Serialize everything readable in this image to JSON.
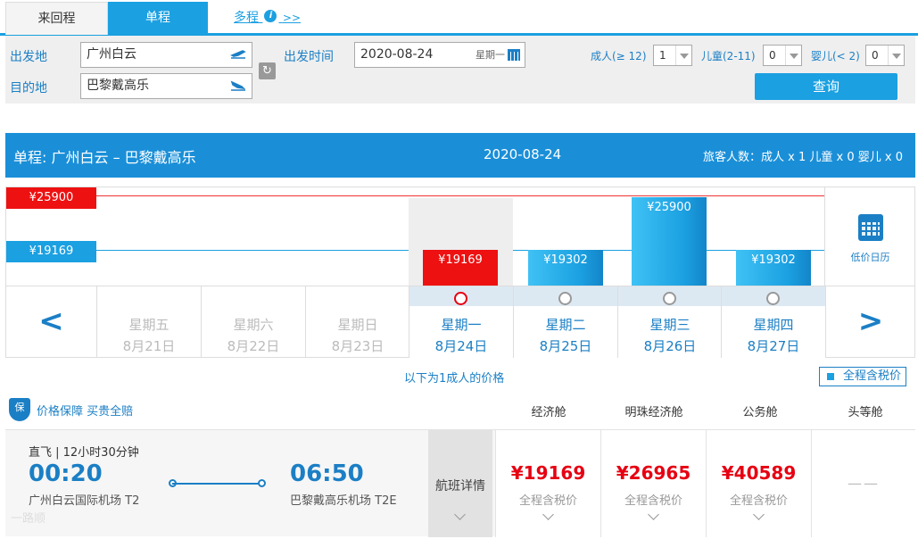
{
  "tabs": {
    "round_trip": "来回程",
    "one_way": "单程",
    "multi_city": "多程",
    "multi_suffix": ">>",
    "info_glyph": "i"
  },
  "search": {
    "origin_label": "出发地",
    "origin_value": "广州白云",
    "dest_label": "目的地",
    "dest_value": "巴黎戴高乐",
    "date_label": "出发时间",
    "date_value": "2020-08-24",
    "date_weekday": "星期一",
    "adult_label": "成人(≥ 12)",
    "adult_value": "1",
    "child_label": "儿童(2-11)",
    "child_value": "0",
    "infant_label": "婴儿(< 2)",
    "infant_value": "0",
    "query_button": "查询"
  },
  "summary": {
    "route": "单程:  广州白云  –  巴黎戴高乐",
    "date": "2020-08-24",
    "passengers": "旅客人数：成人 x 1   儿童 x 0   婴儿 x 0"
  },
  "price_chart": {
    "max_label": "¥25900",
    "min_label": "¥19169",
    "calendar_label": "低价日历",
    "bars": [
      {
        "label": "¥19169",
        "value": 19169,
        "selected": true
      },
      {
        "label": "¥19302",
        "value": 19302
      },
      {
        "label": "¥25900",
        "value": 25900
      },
      {
        "label": "¥19302",
        "value": 19302
      }
    ],
    "days": [
      {
        "weekday": "星期五",
        "date": "8月21日",
        "state": "past"
      },
      {
        "weekday": "星期六",
        "date": "8月22日",
        "state": "past"
      },
      {
        "weekday": "星期日",
        "date": "8月23日",
        "state": "past"
      },
      {
        "weekday": "星期一",
        "date": "8月24日",
        "state": "selected"
      },
      {
        "weekday": "星期二",
        "date": "8月25日",
        "state": "active"
      },
      {
        "weekday": "星期三",
        "date": "8月26日",
        "state": "active"
      },
      {
        "weekday": "星期四",
        "date": "8月27日",
        "state": "active"
      }
    ]
  },
  "note": "以下为1成人的价格",
  "tax_toggle": "全程含税价",
  "guarantee": {
    "badge": "保",
    "text": "价格保障  买贵全赔"
  },
  "cabins": [
    "经济舱",
    "明珠经济舱",
    "公务舱",
    "头等舱"
  ],
  "flight": {
    "type": "直飞 | 12小时30分钟",
    "dep_time": "00:20",
    "dep_airport": "广州白云国际机场 T2",
    "arr_time": "06:50",
    "arr_airport": "巴黎戴高乐机场 T2E",
    "details": "航班详情",
    "prices": [
      {
        "price": "¥19169",
        "sub": "全程含税价"
      },
      {
        "price": "¥26965",
        "sub": "全程含税价"
      },
      {
        "price": "¥40589",
        "sub": "全程含税价"
      },
      {
        "price": "",
        "sub": "",
        "dash": "——"
      }
    ],
    "watermark": "一路顺"
  }
}
